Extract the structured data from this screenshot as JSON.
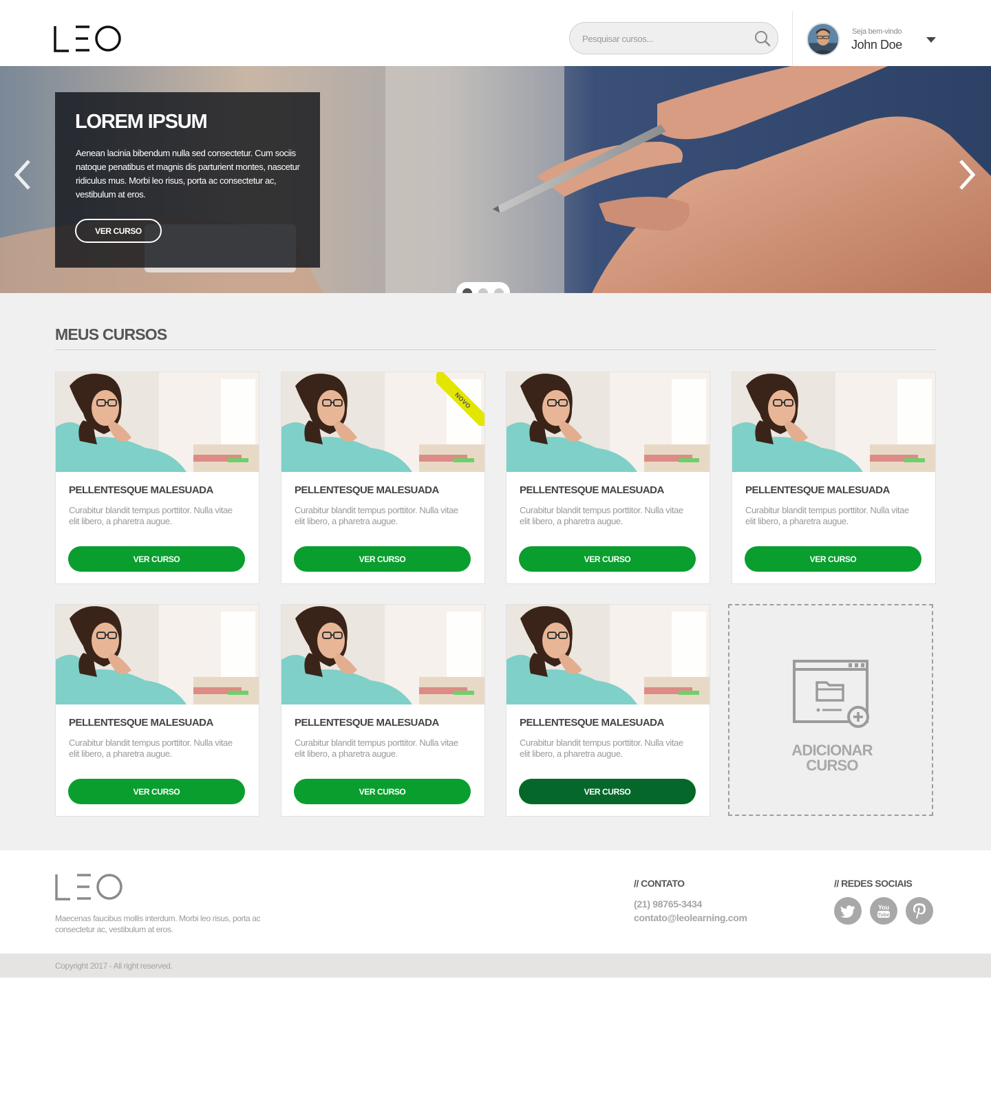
{
  "brand": {
    "logo_text": "LEO"
  },
  "header": {
    "search_placeholder": "Pesquisar cursos...",
    "welcome": "Seja bem-vindo",
    "username": "John Doe"
  },
  "hero": {
    "title": "LOREM IPSUM",
    "text": "Aenean lacinia bibendum nulla sed consectetur. Cum sociis natoque penatibus et magnis dis parturient montes, nascetur ridiculus mus. Morbi leo risus, porta ac consectetur ac, vestibulum at eros.",
    "button": "VER CURSO",
    "slides": 3,
    "active_slide": 1
  },
  "courses": {
    "section_title": "MEUS CURSOS",
    "items": [
      {
        "title": "PELLENTESQUE MALESUADA",
        "desc": "Curabitur blandit tempus porttitor. Nulla vitae elit libero, a pharetra augue.",
        "button": "VER CURSO"
      },
      {
        "title": "PELLENTESQUE MALESUADA",
        "desc": "Curabitur blandit tempus porttitor. Nulla vitae elit libero, a pharetra augue.",
        "button": "VER CURSO",
        "badge": "NOVO"
      },
      {
        "title": "PELLENTESQUE MALESUADA",
        "desc": "Curabitur blandit tempus porttitor. Nulla vitae elit libero, a pharetra augue.",
        "button": "VER CURSO"
      },
      {
        "title": "PELLENTESQUE MALESUADA",
        "desc": "Curabitur blandit tempus porttitor. Nulla vitae elit libero, a pharetra augue.",
        "button": "VER CURSO"
      },
      {
        "title": "PELLENTESQUE MALESUADA",
        "desc": "Curabitur blandit tempus porttitor. Nulla vitae elit libero, a pharetra augue.",
        "button": "VER CURSO"
      },
      {
        "title": "PELLENTESQUE MALESUADA",
        "desc": "Curabitur blandit tempus porttitor. Nulla vitae elit libero, a pharetra augue.",
        "button": "VER CURSO"
      },
      {
        "title": "PELLENTESQUE MALESUADA",
        "desc": "Curabitur blandit tempus porttitor. Nulla vitae elit libero, a pharetra augue.",
        "button": "VER CURSO"
      }
    ],
    "add_line1": "ADICIONAR",
    "add_line2": "CURSO"
  },
  "footer": {
    "desc": "Maecenas faucibus mollis interdum. Morbi leo risus, porta ac consectetur ac, vestibulum at eros.",
    "contact_heading": "// CONTATO",
    "phone": "(21) 98765-3434",
    "email": "contato@leolearning.com",
    "social_heading": "// REDES SOCIAIS",
    "social": [
      "twitter-icon",
      "youtube-icon",
      "pinterest-icon"
    ],
    "copyright": "Copyright 2017 - All right reserved."
  },
  "colors": {
    "accent_green": "#0a9e2f",
    "accent_green_hover": "#05682a",
    "badge_yellow": "#e2e600"
  }
}
